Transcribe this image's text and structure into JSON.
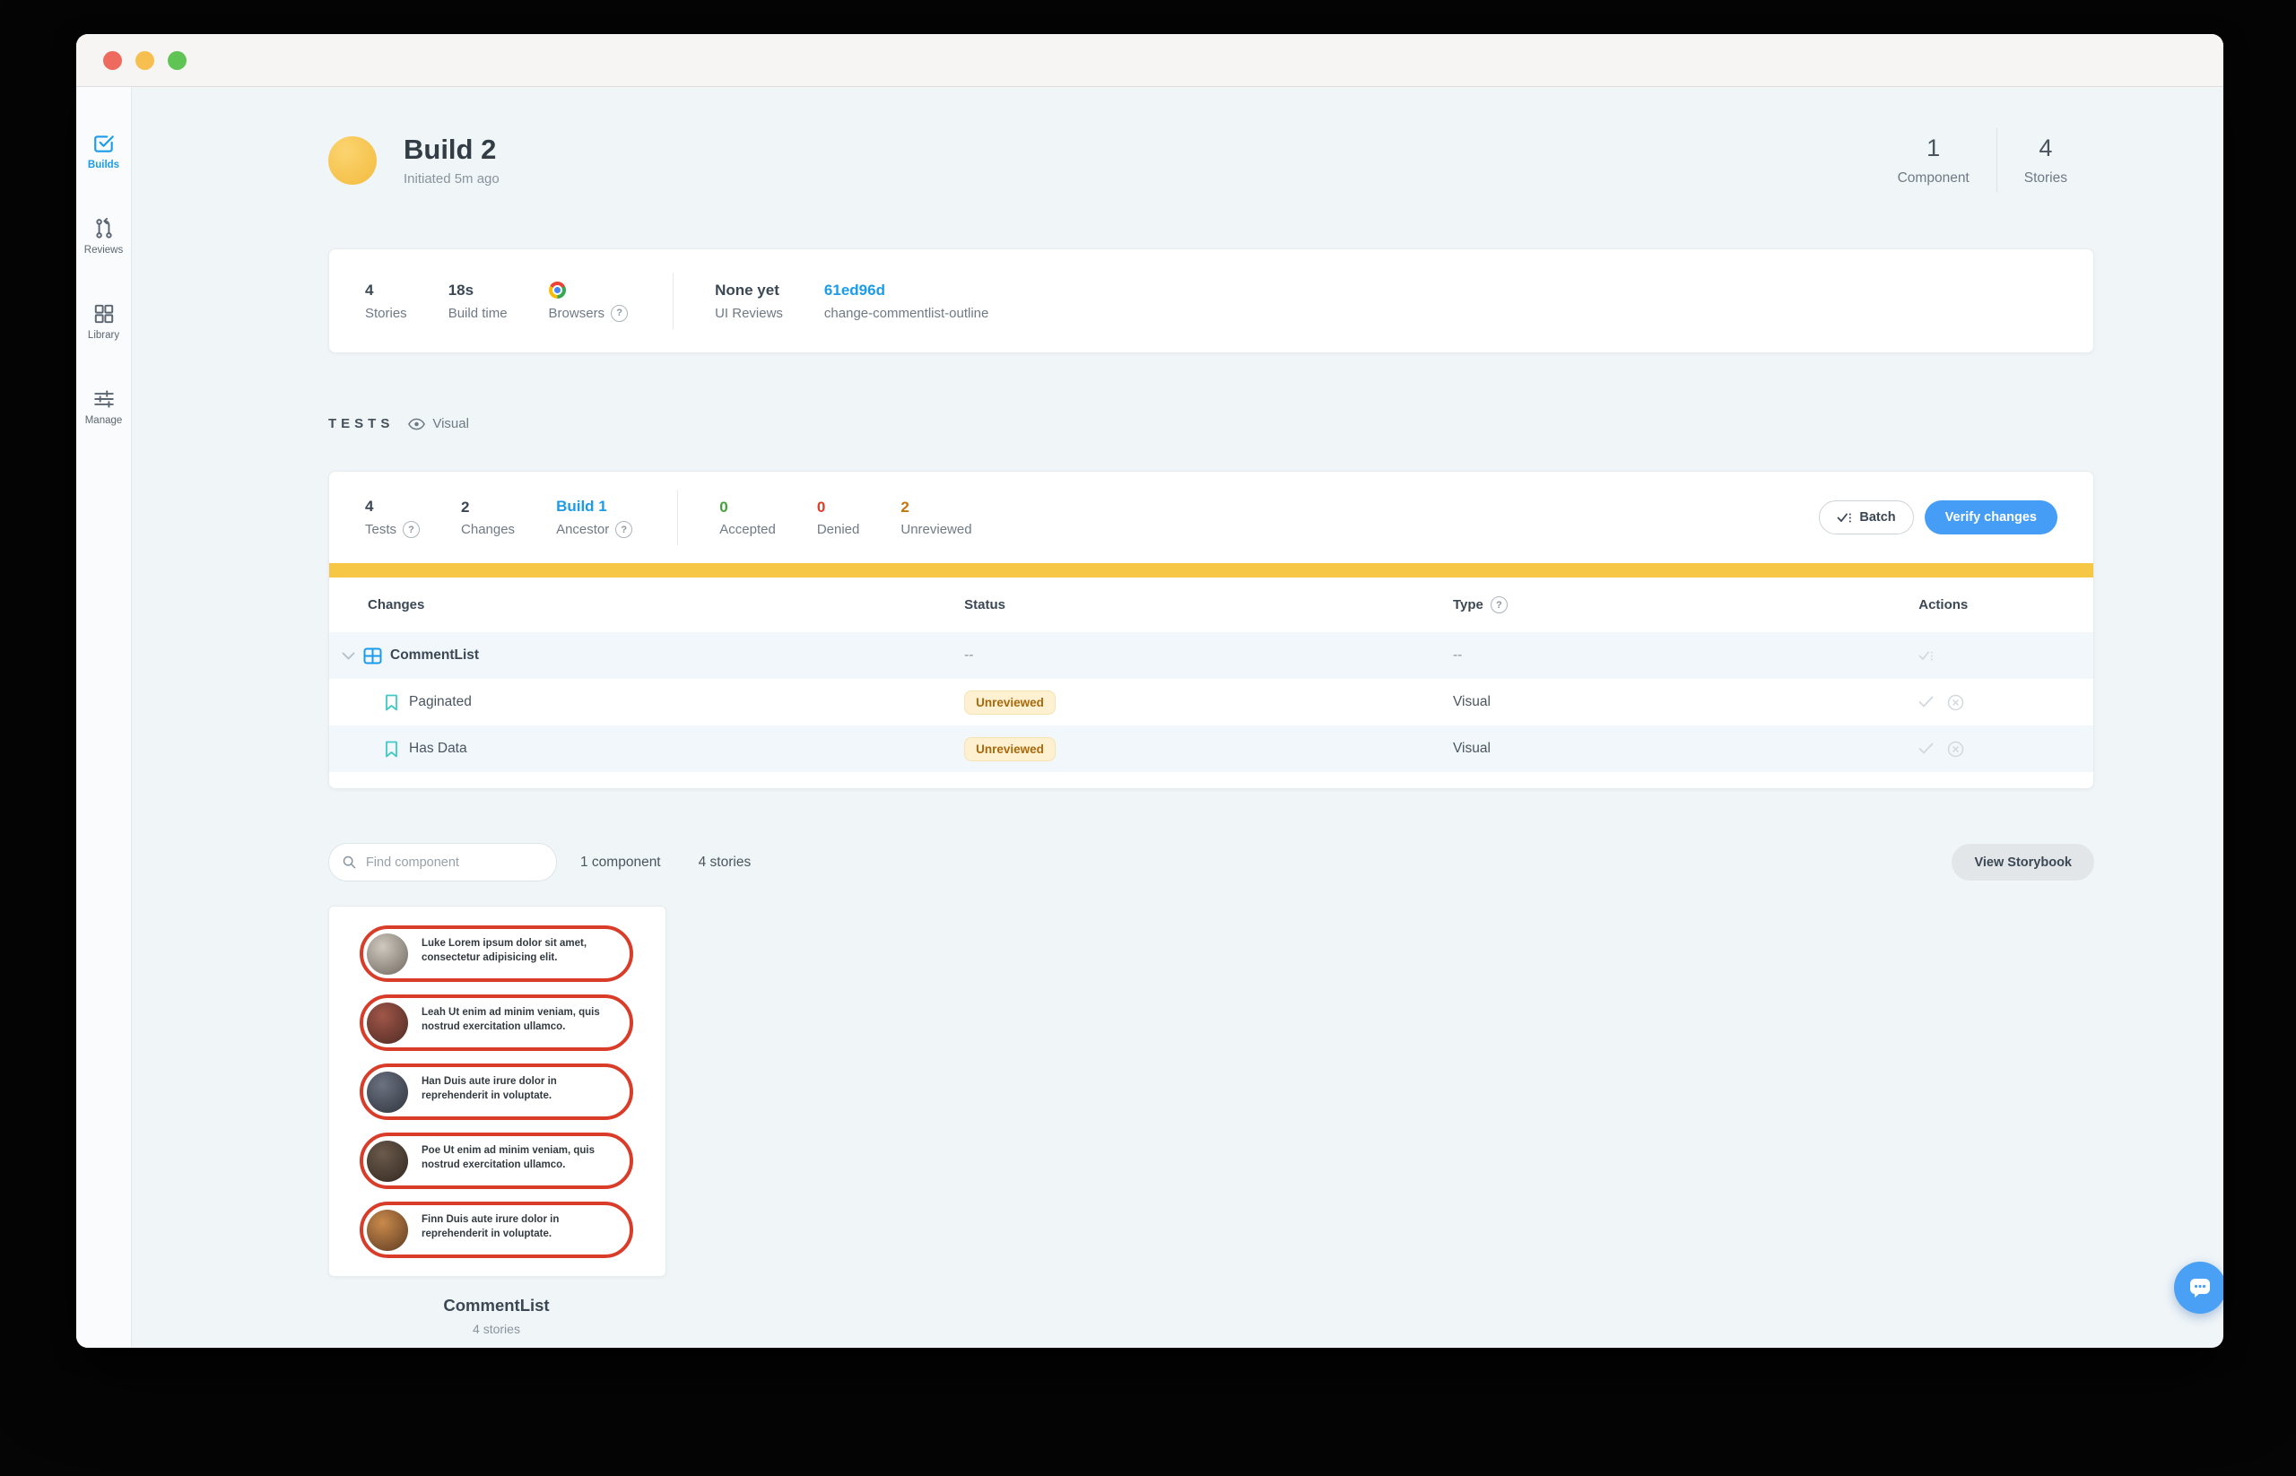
{
  "colors": {
    "accent_blue": "#1b9ceb",
    "verify_button_blue": "#459df5",
    "progress_yellow": "#f6c645",
    "accepted_green": "#44a13c",
    "denied_red": "#e03d28",
    "unreviewed_orange": "#c4760c",
    "badge_bg": "#fdf1d2",
    "badge_text": "#a9690b",
    "story_outline_red": "#d93d2a",
    "avatar_yellow": "#f3bb3e",
    "traffic_lights": [
      "#ef6a5e",
      "#f6bf4f",
      "#5fc454"
    ]
  },
  "sidebar": {
    "items": [
      {
        "label": "Builds",
        "icon": "builds-icon",
        "active": true
      },
      {
        "label": "Reviews",
        "icon": "reviews-icon",
        "active": false
      },
      {
        "label": "Library",
        "icon": "library-icon",
        "active": false
      },
      {
        "label": "Manage",
        "icon": "manage-icon",
        "active": false
      }
    ]
  },
  "header": {
    "title": "Build 2",
    "subtitle": "Initiated 5m ago",
    "stats": [
      {
        "value": "1",
        "label": "Component"
      },
      {
        "value": "4",
        "label": "Stories"
      }
    ]
  },
  "summary": {
    "stories_value": "4",
    "stories_label": "Stories",
    "build_time_value": "18s",
    "build_time_label": "Build time",
    "browsers_label": "Browsers",
    "browsers_icon": "chrome-icon",
    "ui_reviews_value": "None yet",
    "ui_reviews_label": "UI Reviews",
    "commit_value": "61ed96d",
    "commit_label": "change-commentlist-outline"
  },
  "tests": {
    "section_label": "TESTS",
    "mode_label": "Visual",
    "tests_value": "4",
    "tests_label": "Tests",
    "changes_value": "2",
    "changes_label": "Changes",
    "ancestor_value": "Build 1",
    "ancestor_label": "Ancestor",
    "accepted_value": "0",
    "accepted_label": "Accepted",
    "denied_value": "0",
    "denied_label": "Denied",
    "unreviewed_value": "2",
    "unreviewed_label": "Unreviewed",
    "batch_label": "Batch",
    "verify_label": "Verify changes"
  },
  "table": {
    "headers": {
      "changes": "Changes",
      "status": "Status",
      "type": "Type",
      "actions": "Actions"
    },
    "rows": [
      {
        "name": "CommentList",
        "status": "--",
        "type": "--",
        "kind": "component"
      },
      {
        "name": "Paginated",
        "status": "Unreviewed",
        "type": "Visual",
        "kind": "story"
      },
      {
        "name": "Has Data",
        "status": "Unreviewed",
        "type": "Visual",
        "kind": "story"
      }
    ]
  },
  "storybook": {
    "search_placeholder": "Find component",
    "component_count": "1 component",
    "story_count": "4 stories",
    "view_button": "View Storybook",
    "card": {
      "title": "CommentList",
      "subtitle": "4 stories",
      "comments": [
        {
          "text": "Luke Lorem ipsum dolor sit amet, consectetur adipisicing elit.",
          "avatar_colors": [
            "#cfc9c0",
            "#6f675e"
          ]
        },
        {
          "text": "Leah Ut enim ad minim veniam, quis nostrud exercitation ullamco.",
          "avatar_colors": [
            "#a05648",
            "#4e2a24"
          ]
        },
        {
          "text": "Han Duis aute irure dolor in reprehenderit in voluptate.",
          "avatar_colors": [
            "#6b7280",
            "#2f333c"
          ]
        },
        {
          "text": "Poe Ut enim ad minim veniam, quis nostrud exercitation ullamco.",
          "avatar_colors": [
            "#6b5a4c",
            "#32281f"
          ]
        },
        {
          "text": "Finn Duis aute irure dolor in reprehenderit in voluptate.",
          "avatar_colors": [
            "#c98a4b",
            "#5d3a22"
          ]
        }
      ]
    }
  }
}
